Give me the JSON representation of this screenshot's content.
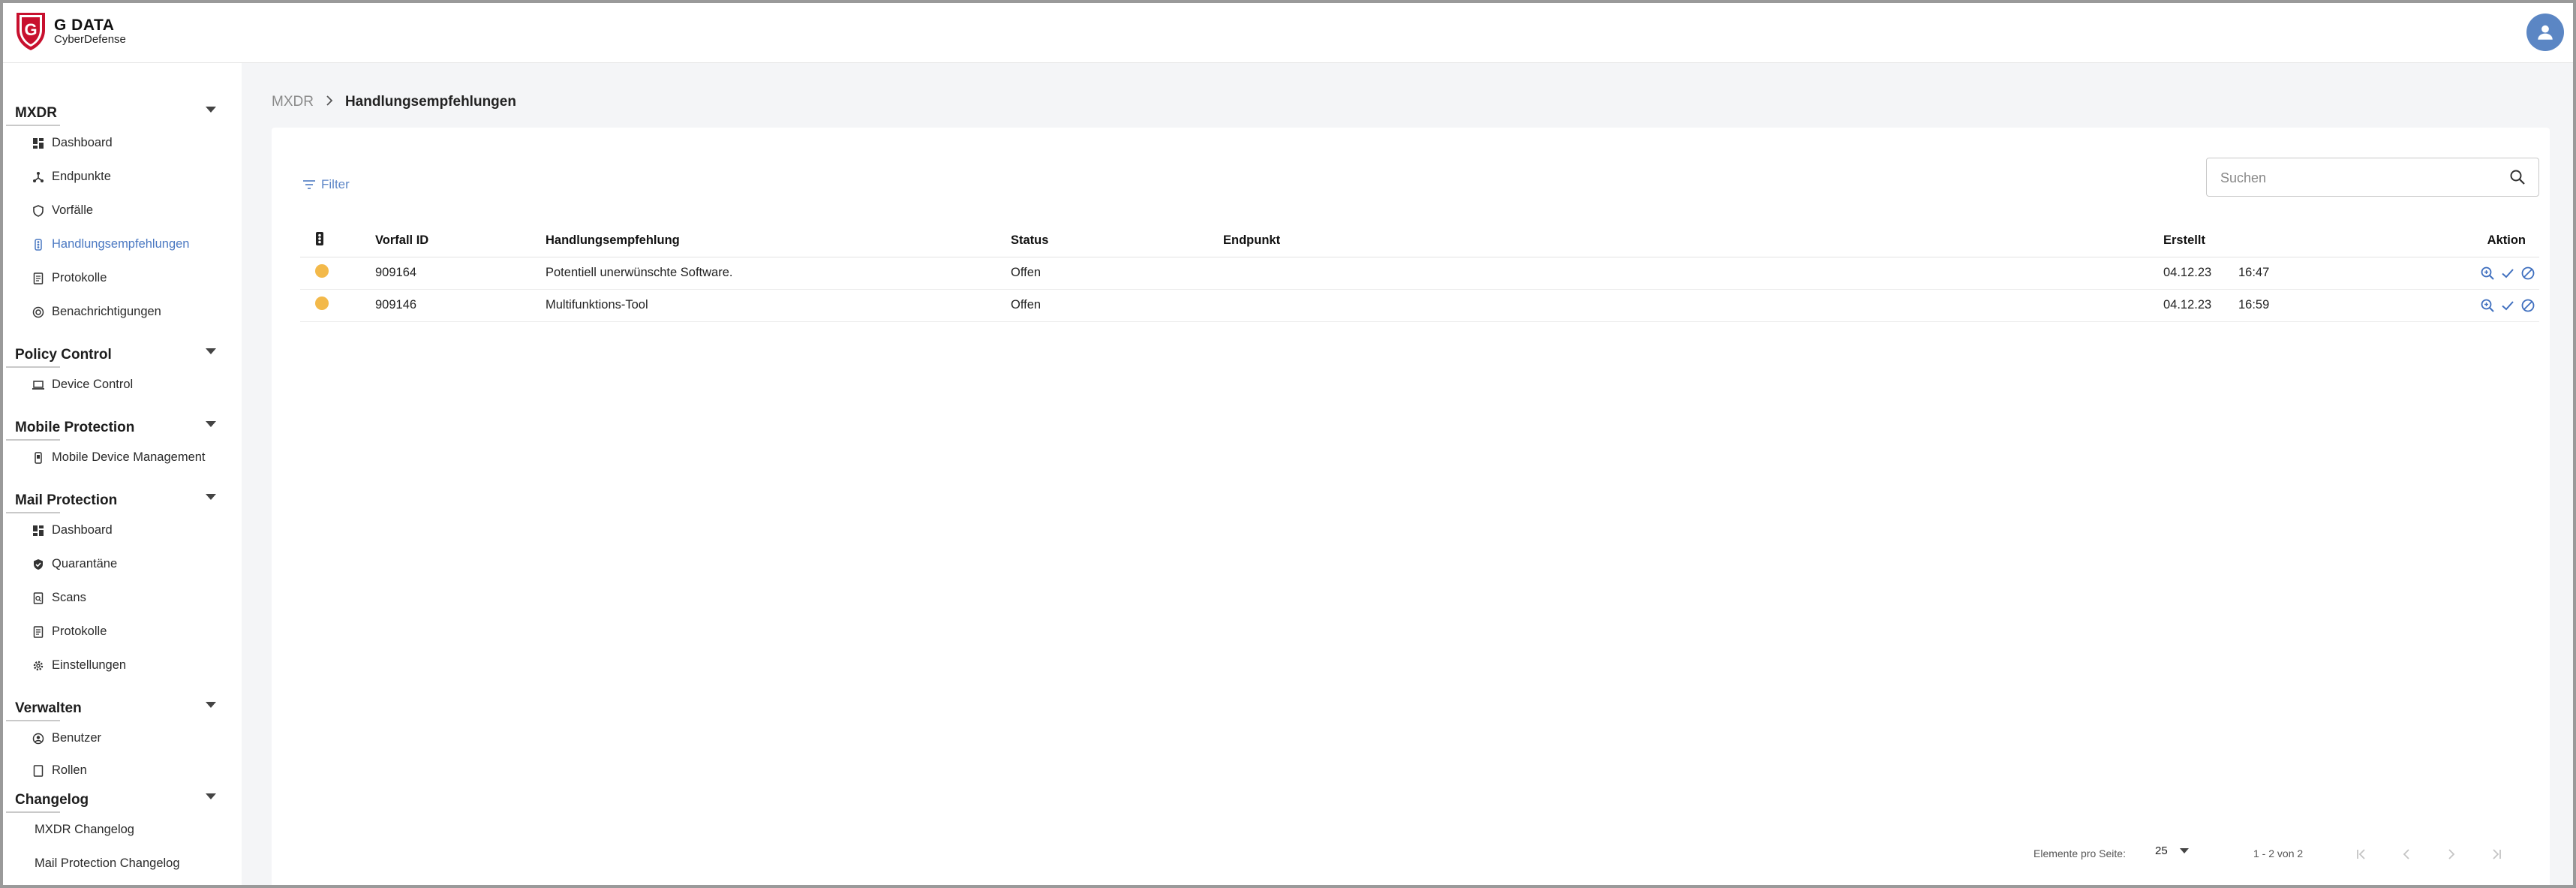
{
  "app": {
    "brand": "G DATA",
    "product": "CyberDefense"
  },
  "sidebar": {
    "sections": [
      {
        "title": "MXDR",
        "items": [
          {
            "label": "Dashboard",
            "icon": "dashboard-icon"
          },
          {
            "label": "Endpunkte",
            "icon": "network-icon"
          },
          {
            "label": "Vorfälle",
            "icon": "shield-icon"
          },
          {
            "label": "Handlungsempfehlungen",
            "icon": "traffic-light-icon",
            "active": true
          },
          {
            "label": "Protokolle",
            "icon": "document-icon"
          },
          {
            "label": "Benachrichtigungen",
            "icon": "notification-icon"
          }
        ]
      },
      {
        "title": "Policy Control",
        "items": [
          {
            "label": "Device Control",
            "icon": "laptop-icon"
          }
        ]
      },
      {
        "title": "Mobile Protection",
        "items": [
          {
            "label": "Mobile Device Management",
            "icon": "mobile-icon"
          }
        ]
      },
      {
        "title": "Mail Protection",
        "items": [
          {
            "label": "Dashboard",
            "icon": "dashboard-icon"
          },
          {
            "label": "Quarantäne",
            "icon": "shield-check-icon"
          },
          {
            "label": "Scans",
            "icon": "scan-document-icon"
          },
          {
            "label": "Protokolle",
            "icon": "document-icon"
          },
          {
            "label": "Einstellungen",
            "icon": "gear-icon"
          }
        ]
      },
      {
        "title": "Verwalten",
        "items": [
          {
            "label": "Benutzer",
            "icon": "user-circle-icon"
          },
          {
            "label": "Rollen",
            "icon": "document-icon"
          }
        ]
      },
      {
        "title": "Changelog",
        "items": [
          {
            "label": "MXDR Changelog"
          },
          {
            "label": "Mail Protection Changelog"
          }
        ]
      }
    ]
  },
  "breadcrumb": {
    "root": "MXDR",
    "current": "Handlungsempfehlungen"
  },
  "toolbar": {
    "filter_label": "Filter",
    "search_placeholder": "Suchen"
  },
  "table": {
    "columns": {
      "vorfall_id": "Vorfall ID",
      "handlungsempfehlung": "Handlungsempfehlung",
      "status": "Status",
      "endpunkt": "Endpunkt",
      "erstellt": "Erstellt",
      "aktion": "Aktion"
    },
    "rows": [
      {
        "severity_color": "#f3b94a",
        "vorfall_id": "909164",
        "handlungsempfehlung": "Potentiell unerwünschte Software.",
        "status": "Offen",
        "endpunkt": "",
        "datum": "04.12.23",
        "zeit": "16:47"
      },
      {
        "severity_color": "#f3b94a",
        "vorfall_id": "909146",
        "handlungsempfehlung": "Multifunktions-Tool",
        "status": "Offen",
        "endpunkt": "",
        "datum": "04.12.23",
        "zeit": "16:59"
      }
    ]
  },
  "pagination": {
    "per_page_label": "Elemente pro Seite:",
    "per_page_value": "25",
    "range": "1 - 2 von 2"
  },
  "colors": {
    "accent": "#4a78c2",
    "severity_medium": "#f3b94a",
    "avatar": "#5b86c4"
  }
}
